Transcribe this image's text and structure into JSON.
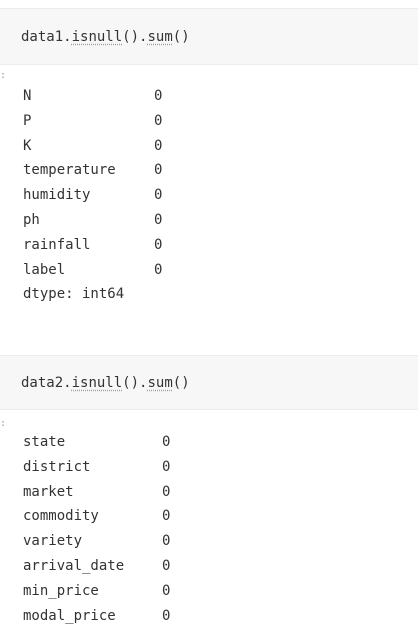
{
  "cell1": {
    "code": {
      "var": "data1",
      "fn1": "isnull",
      "fn2": "sum",
      "parens": "()"
    },
    "prompt_mark": ":",
    "rows": [
      {
        "name": "N",
        "value": "0"
      },
      {
        "name": "P",
        "value": "0"
      },
      {
        "name": "K",
        "value": "0"
      },
      {
        "name": "temperature",
        "value": "0"
      },
      {
        "name": "humidity",
        "value": "0"
      },
      {
        "name": "ph",
        "value": "0"
      },
      {
        "name": "rainfall",
        "value": "0"
      },
      {
        "name": "label",
        "value": "0"
      }
    ],
    "dtype": "dtype: int64"
  },
  "cell2": {
    "code": {
      "var": "data2",
      "fn1": "isnull",
      "fn2": "sum",
      "parens": "()"
    },
    "prompt_mark": ":",
    "rows": [
      {
        "name": "state",
        "value": "0"
      },
      {
        "name": "district",
        "value": "0"
      },
      {
        "name": "market",
        "value": "0"
      },
      {
        "name": "commodity",
        "value": "0"
      },
      {
        "name": "variety",
        "value": "0"
      },
      {
        "name": "arrival_date",
        "value": "0"
      },
      {
        "name": "min_price",
        "value": "0"
      },
      {
        "name": "modal_price",
        "value": "0"
      }
    ]
  }
}
